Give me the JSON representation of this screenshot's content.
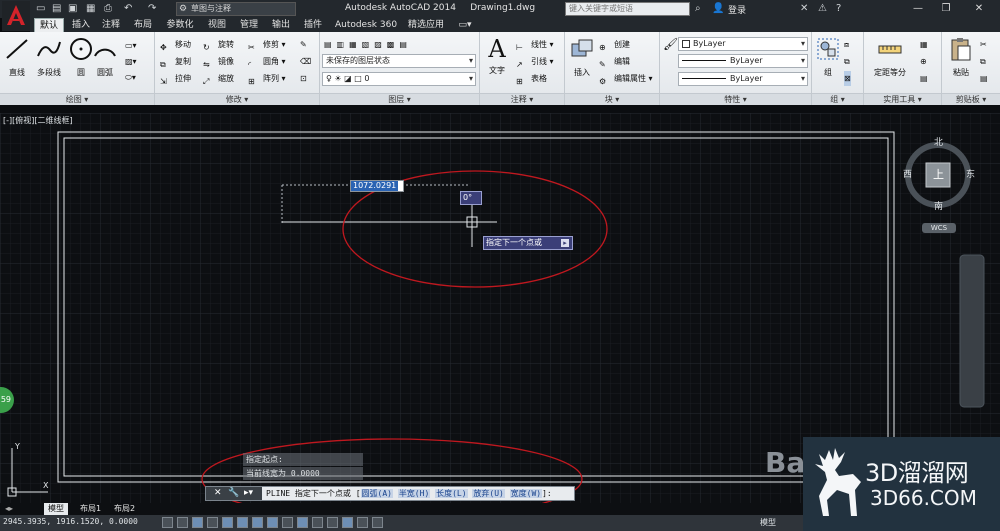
{
  "titlebar": {
    "workspace": "草图与注释",
    "title": "Autodesk AutoCAD 2014     Drawing1.dwg",
    "search_placeholder": "键入关键字或短语",
    "login": "登录"
  },
  "tabs": [
    "默认",
    "插入",
    "注释",
    "布局",
    "参数化",
    "视图",
    "管理",
    "输出",
    "插件",
    "Autodesk 360",
    "精选应用"
  ],
  "ribbon": {
    "draw": {
      "title": "绘图",
      "line": "直线",
      "polyline": "多段线",
      "circle": "圆",
      "arc": "圆弧"
    },
    "modify": {
      "title": "修改",
      "items": [
        "移动",
        "旋转",
        "修剪",
        "复制",
        "镜像",
        "圆角",
        "拉伸",
        "缩放",
        "阵列"
      ]
    },
    "layers": {
      "title": "图层",
      "state": "未保存的图层状态",
      "current": "0"
    },
    "annotation": {
      "title": "注释",
      "text": "文字",
      "linear": "线性",
      "leader": "引线",
      "table": "表格"
    },
    "block": {
      "title": "块",
      "insert": "插入",
      "create": "创建",
      "edit": "编辑",
      "edit_attr": "编辑属性"
    },
    "properties": {
      "title": "特性",
      "color": "ByLayer",
      "linetype": "ByLayer",
      "lineweight": "ByLayer"
    },
    "groups": {
      "title": "组",
      "group": "组"
    },
    "utilities": {
      "title": "实用工具",
      "measure": "定距等分"
    },
    "clipboard": {
      "title": "剪贴板",
      "paste": "粘贴"
    }
  },
  "viewport": {
    "label": "[-][俯视][二维线框]",
    "dyn_input_length": "1072.0291",
    "dyn_input_angle": "0°",
    "tooltip": "指定下一个点或",
    "viewcube": {
      "north": "北",
      "south": "南",
      "east": "东",
      "west": "西",
      "top": "上",
      "wcs": "WCS"
    },
    "badge": "59"
  },
  "command": {
    "history": [
      "指定起点:",
      "当前线宽为 0.0000"
    ],
    "prompt": "PLINE 指定下一个点或 [",
    "options": [
      "圆弧(A)",
      "半宽(H)",
      "长度(L)",
      "放弃(U)",
      "宽度(W)"
    ],
    "suffix": "]:"
  },
  "layout_tabs": [
    "模型",
    "布局1",
    "布局2"
  ],
  "status": {
    "coords": "2945.3935, 1916.1520, 0.0000",
    "model": "模型"
  },
  "watermark": {
    "text": "3D溜溜网",
    "sub": "3D66.COM",
    "bai": "Bai"
  },
  "colors": {
    "annotation_ellipse": "#c0181f",
    "accent": "#2a63b3"
  }
}
